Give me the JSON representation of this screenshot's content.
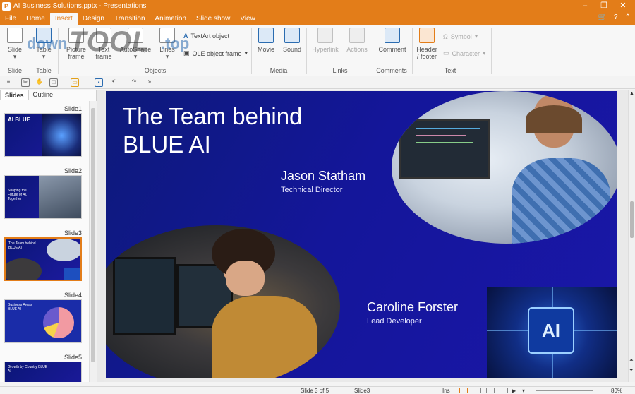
{
  "window": {
    "title": "AI Business Solutions.pptx - Presentations"
  },
  "menu": [
    {
      "label": "File"
    },
    {
      "label": "Home"
    },
    {
      "label": "Insert",
      "active": true
    },
    {
      "label": "Design"
    },
    {
      "label": "Transition"
    },
    {
      "label": "Animation"
    },
    {
      "label": "Slide show"
    },
    {
      "label": "View"
    }
  ],
  "ribbon": {
    "slide": "Slide",
    "table": "Table",
    "picture_frame": "Picture\nframe",
    "text_frame": "Text\nframe",
    "autoshape": "AutoShape",
    "lines": "Lines",
    "textart": "TextArt object",
    "ole": "OLE object frame",
    "movie": "Movie",
    "sound": "Sound",
    "hyperlink": "Hyperlink",
    "actions": "Actions",
    "comment": "Comment",
    "header_footer": "Header\n/ footer",
    "symbol": "Symbol",
    "character": "Character",
    "groups": {
      "slide": "Slide",
      "table": "Table",
      "objects": "Objects",
      "media": "Media",
      "links": "Links",
      "comments": "Comments",
      "text": "Text"
    }
  },
  "panel": {
    "tab_slides": "Slides",
    "tab_outline": "Outline"
  },
  "thumbnails": [
    {
      "label": "Slide1",
      "text": "AI BLUE"
    },
    {
      "label": "Slide2",
      "text": "Shaping the Future of AI, Together"
    },
    {
      "label": "Slide3",
      "text": "The Team behind BLUE AI"
    },
    {
      "label": "Slide4",
      "text": "Business Areas BLUE AI"
    },
    {
      "label": "Slide5",
      "text": "Growth by Country BLUE AI"
    }
  ],
  "slide": {
    "title_line1": "The Team behind",
    "title_line2": "BLUE AI",
    "person1_name": "Jason Statham",
    "person1_role": "Technical Director",
    "person2_name": "Caroline Forster",
    "person2_role": "Lead Developer",
    "chip_text": "AI"
  },
  "watermark": {
    "left": "down",
    "center": "TOOL",
    "right": ".top"
  },
  "status": {
    "slide_pos": "Slide 3 of 5",
    "slide_name": "Slide3",
    "mode": "Ins",
    "zoom": "80%"
  },
  "colors": {
    "accent": "#e37d19",
    "slide_bg": "#14169a"
  }
}
